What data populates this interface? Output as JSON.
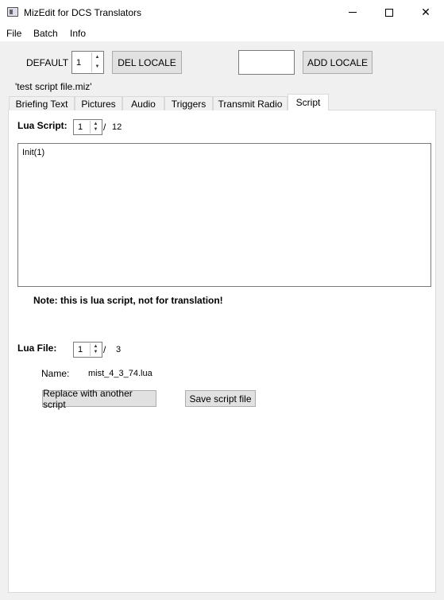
{
  "window": {
    "title": "MizEdit for DCS Translators",
    "minimize_glyph": "",
    "close_glyph": "✕"
  },
  "menu": [
    "File",
    "Batch",
    "Info"
  ],
  "locale": {
    "label": "DEFAULT",
    "spin_value": "1",
    "del_button": "DEL LOCALE",
    "add_input_value": "",
    "add_button": "ADD LOCALE"
  },
  "file_name": "'test script file.miz'",
  "tabs": [
    "Briefing Text",
    "Pictures",
    "Audio",
    "Triggers",
    "Transmit Radio",
    "Script"
  ],
  "active_tab": "Script",
  "script": {
    "lua_script_label": "Lua Script:",
    "script_index": "1",
    "separator": "/",
    "script_total": "12",
    "editor_text": "Init(1)",
    "note": "Note: this is lua script, not for translation!",
    "lua_file_label": "Lua File:",
    "file_index": "1",
    "file_total": "3",
    "name_label": "Name:",
    "name_value": "mist_4_3_74.lua",
    "replace_button": "Replace with another script",
    "save_button": "Save script file"
  },
  "icons": {
    "app": "app-window-icon",
    "spin_up": "▲",
    "spin_down": "▼"
  }
}
